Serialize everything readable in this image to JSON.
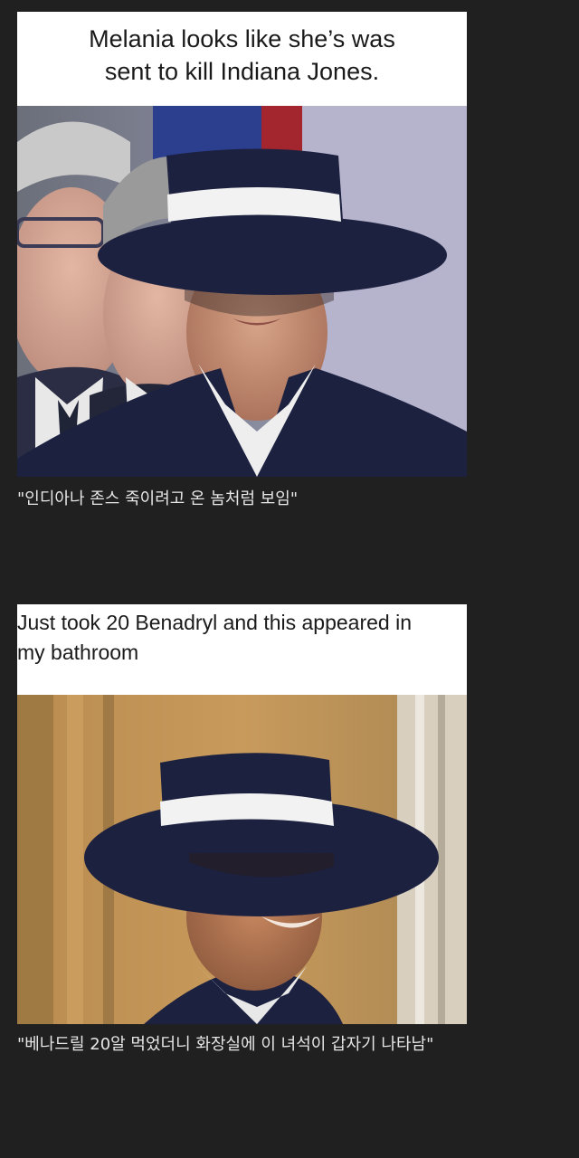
{
  "posts": [
    {
      "meme_text": "Melania looks like she’s was sent to kill Indiana Jones.",
      "meme_text_line1": "Melania looks like she’s was",
      "meme_text_line2": "sent to kill Indiana Jones.",
      "caption": "\"인디아나 존스 죽이려고 온 놈처럼 보임\""
    },
    {
      "meme_text_line1": "Just took 20 Benadryl and this appeared in",
      "meme_text_line2": "my bathroom",
      "caption": "\"베나드릴 20알 먹었더니 화장실에 이 녀석이 갑자기 나타남\""
    }
  ],
  "colors": {
    "background": "#202020",
    "caption_text": "#e6e6e6",
    "meme_header_bg": "#ffffff",
    "hat_navy": "#1c2140",
    "hat_band": "#f2f2f2"
  }
}
